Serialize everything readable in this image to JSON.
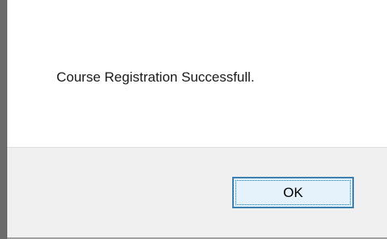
{
  "dialog": {
    "message": "Course Registration Successfull.",
    "ok_label": "OK"
  }
}
